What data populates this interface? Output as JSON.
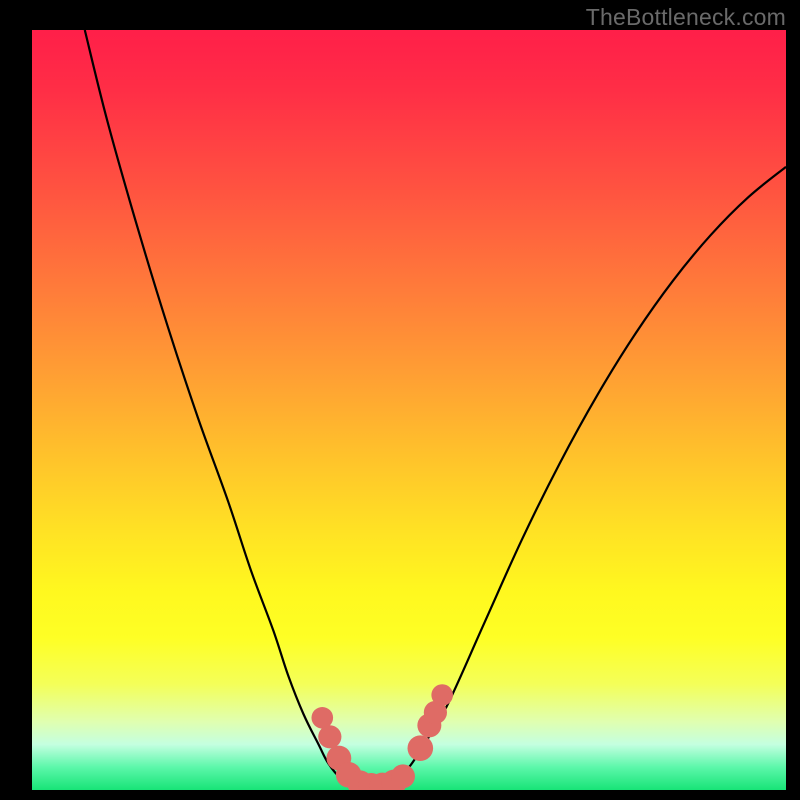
{
  "watermark": "TheBottleneck.com",
  "colors": {
    "background": "#000000",
    "curve": "#000000",
    "marker": "#df6b65"
  },
  "chart_data": {
    "type": "line",
    "title": "",
    "xlabel": "",
    "ylabel": "",
    "xlim": [
      0,
      100
    ],
    "ylim": [
      0,
      100
    ],
    "grid": false,
    "legend": false,
    "series": [
      {
        "name": "bottleneck-curve",
        "x": [
          7,
          10,
          14,
          18,
          22,
          26,
          29,
          32,
          34,
          36,
          38,
          39.3,
          41,
          43,
          45,
          48,
          50,
          52,
          55,
          60,
          65,
          70,
          75,
          80,
          85,
          90,
          95,
          100
        ],
        "y": [
          100,
          88,
          74,
          61,
          49,
          38,
          29,
          21,
          15,
          10,
          6,
          3.5,
          1.5,
          0.5,
          0.5,
          1.2,
          3,
          6,
          11,
          22,
          33,
          43,
          52,
          60,
          67,
          73,
          78,
          82
        ]
      }
    ],
    "markers": {
      "name": "highlight-dots",
      "points": [
        {
          "x": 38.5,
          "y": 9.5,
          "r": 1.2
        },
        {
          "x": 39.5,
          "y": 7.0,
          "r": 1.4
        },
        {
          "x": 40.7,
          "y": 4.2,
          "r": 1.6
        },
        {
          "x": 42.0,
          "y": 2.0,
          "r": 1.7
        },
        {
          "x": 43.5,
          "y": 0.9,
          "r": 1.7
        },
        {
          "x": 45.0,
          "y": 0.55,
          "r": 1.7
        },
        {
          "x": 46.5,
          "y": 0.6,
          "r": 1.7
        },
        {
          "x": 48.0,
          "y": 1.0,
          "r": 1.7
        },
        {
          "x": 49.2,
          "y": 1.8,
          "r": 1.5
        },
        {
          "x": 51.5,
          "y": 5.5,
          "r": 1.7
        },
        {
          "x": 52.7,
          "y": 8.5,
          "r": 1.5
        },
        {
          "x": 53.5,
          "y": 10.2,
          "r": 1.4
        },
        {
          "x": 54.4,
          "y": 12.5,
          "r": 1.2
        }
      ]
    }
  }
}
